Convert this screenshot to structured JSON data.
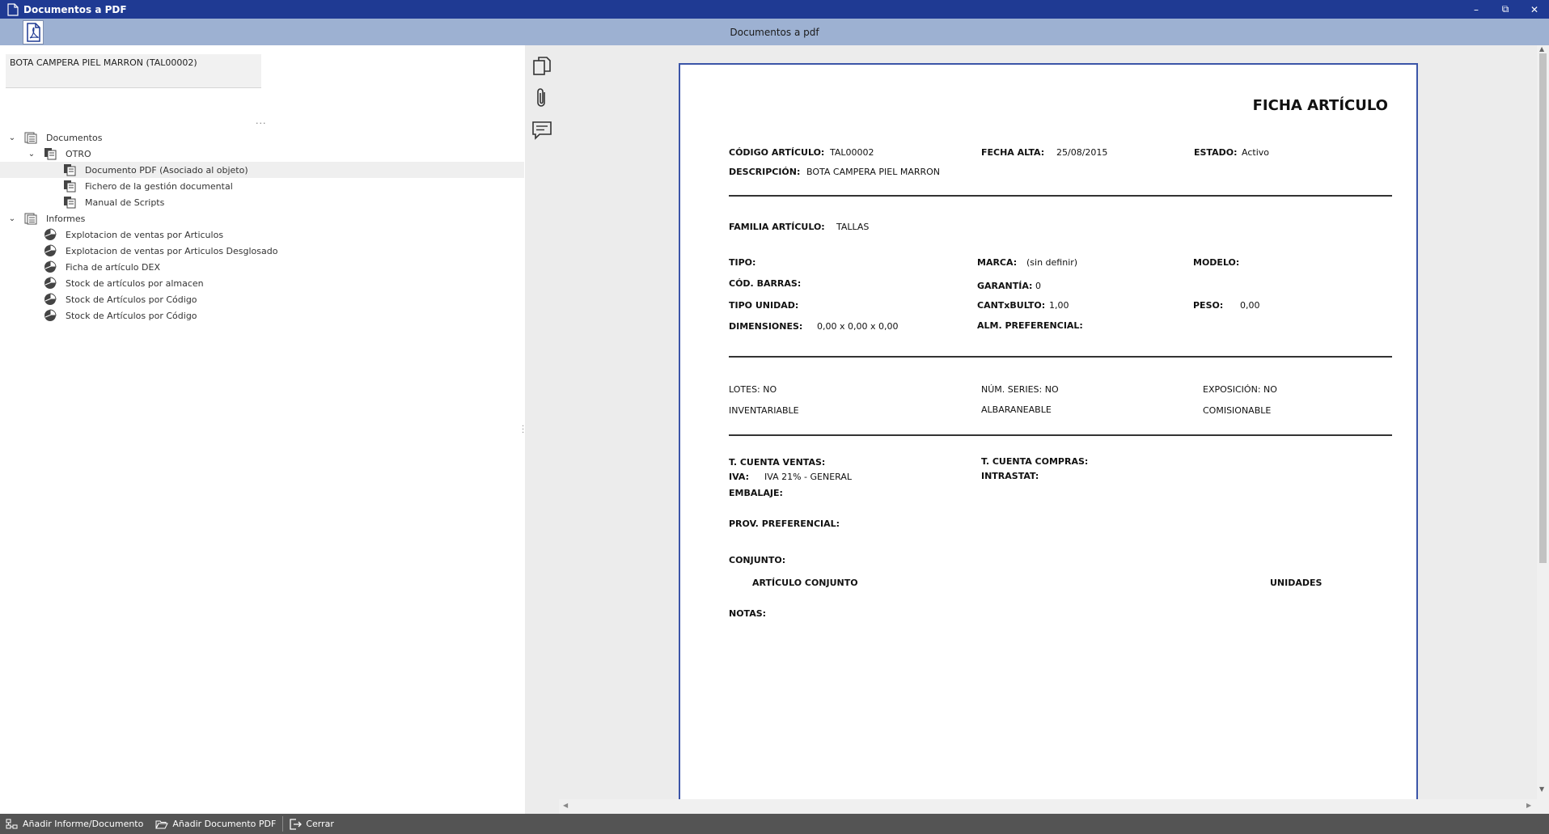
{
  "window": {
    "title": "Documentos a PDF",
    "minimize_glyph": "–",
    "restore_glyph": "⧉",
    "close_glyph": "✕"
  },
  "toolbar": {
    "title": "Documentos a pdf"
  },
  "object": {
    "label": "BOTA CAMPERA PIEL MARRON (TAL00002)"
  },
  "panel": {
    "more_glyph": "..."
  },
  "tree": {
    "documentos": "Documentos",
    "otro": "OTRO",
    "doc_items": [
      "Documento PDF (Asociado al objeto)",
      "Fichero de la gestión documental",
      "Manual de Scripts"
    ],
    "informes": "Informes",
    "informe_items": [
      "Explotacion de ventas por Articulos",
      "Explotacion de ventas por Articulos Desglosado",
      "Ficha de artículo DEX",
      "Stock de artículos por almacen",
      "Stock de Artículos por Código",
      "Stock de Artículos por Código"
    ]
  },
  "document": {
    "title": "FICHA ARTÍCULO",
    "codigo_label": "CÓDIGO ARTÍCULO:",
    "codigo_value": "TAL00002",
    "fecha_label": "FECHA ALTA:",
    "fecha_value": "25/08/2015",
    "estado_label": "ESTADO:",
    "estado_value": "Activo",
    "descripcion_label": "DESCRIPCIÓN:",
    "descripcion_value": "BOTA CAMPERA PIEL MARRON",
    "familia_label": "FAMILIA ARTÍCULO:",
    "familia_value": "TALLAS",
    "tipo_label": "TIPO:",
    "marca_label": "MARCA:",
    "marca_value": "(sin definir)",
    "modelo_label": "MODELO:",
    "codbarras_label": "CÓD. BARRAS:",
    "garantia_label": "GARANTÍA:",
    "garantia_value": "0",
    "tipounidad_label": "TIPO UNIDAD:",
    "cantbulto_label": "CANTxBULTO:",
    "cantbulto_value": "1,00",
    "peso_label": "PESO:",
    "peso_value": "0,00",
    "dimensiones_label": "DIMENSIONES:",
    "dimensiones_value": "0,00 x 0,00 x 0,00",
    "almpref_label": "ALM. PREFERENCIAL:",
    "lotes": "LOTES: NO",
    "numseries": "NÚM. SERIES: NO",
    "exposicion": "EXPOSICIÓN: NO",
    "inventariable": "INVENTARIABLE",
    "albaraneable": "ALBARANEABLE",
    "comisionable": "COMISIONABLE",
    "cuentaventas_label": "T. CUENTA VENTAS:",
    "cuentacompras_label": "T. CUENTA COMPRAS:",
    "iva_label": "IVA:",
    "iva_value": "IVA 21% - GENERAL",
    "intrastat_label": "INTRASTAT:",
    "embalaje_label": "EMBALAJE:",
    "provpref_label": "PROV. PREFERENCIAL:",
    "conjunto_label": "CONJUNTO:",
    "articulo_conjunto": "ARTÍCULO CONJUNTO",
    "unidades": "UNIDADES",
    "notas_label": "NOTAS:"
  },
  "bottombar": {
    "add_report": "Añadir Informe/Documento",
    "add_pdf": "Añadir Documento PDF",
    "close": "Cerrar"
  },
  "colors": {
    "titlebar": "#1f3a93",
    "toolbar": "#9db1d2",
    "page_border": "#3b55a8",
    "bottombar": "#545454"
  }
}
